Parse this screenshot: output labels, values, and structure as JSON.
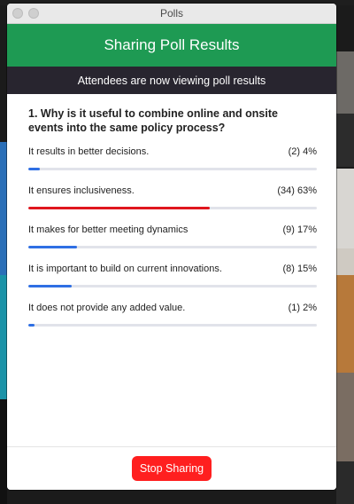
{
  "window": {
    "title": "Polls"
  },
  "header": {
    "title": "Sharing Poll Results"
  },
  "status": {
    "text": "Attendees are now viewing poll results"
  },
  "question": {
    "text": "1. Why is it useful to combine online and onsite events into the same policy process?"
  },
  "options": [
    {
      "label": "It results in better decisions.",
      "result": "(2) 4%",
      "fraction": 0.04,
      "color": "#2f6fe4"
    },
    {
      "label": "It ensures inclusiveness.",
      "result": "(34) 63%",
      "fraction": 0.63,
      "color": "#e0161e"
    },
    {
      "label": "It makes for better meeting dynamics",
      "result": "(9) 17%",
      "fraction": 0.17,
      "color": "#2f6fe4"
    },
    {
      "label": "It is important to build on current innovations.",
      "result": "(8) 15%",
      "fraction": 0.15,
      "color": "#2f6fe4"
    },
    {
      "label": "It does not provide any added value.",
      "result": "(1) 2%",
      "fraction": 0.02,
      "color": "#2f6fe4"
    }
  ],
  "footer": {
    "stop_label": "Stop Sharing"
  },
  "colors": {
    "header_green": "#1e9a53",
    "status_dark": "#28252f",
    "stop_red": "#ff1f1f",
    "bar_blue": "#2f6fe4",
    "bar_red": "#e0161e"
  }
}
